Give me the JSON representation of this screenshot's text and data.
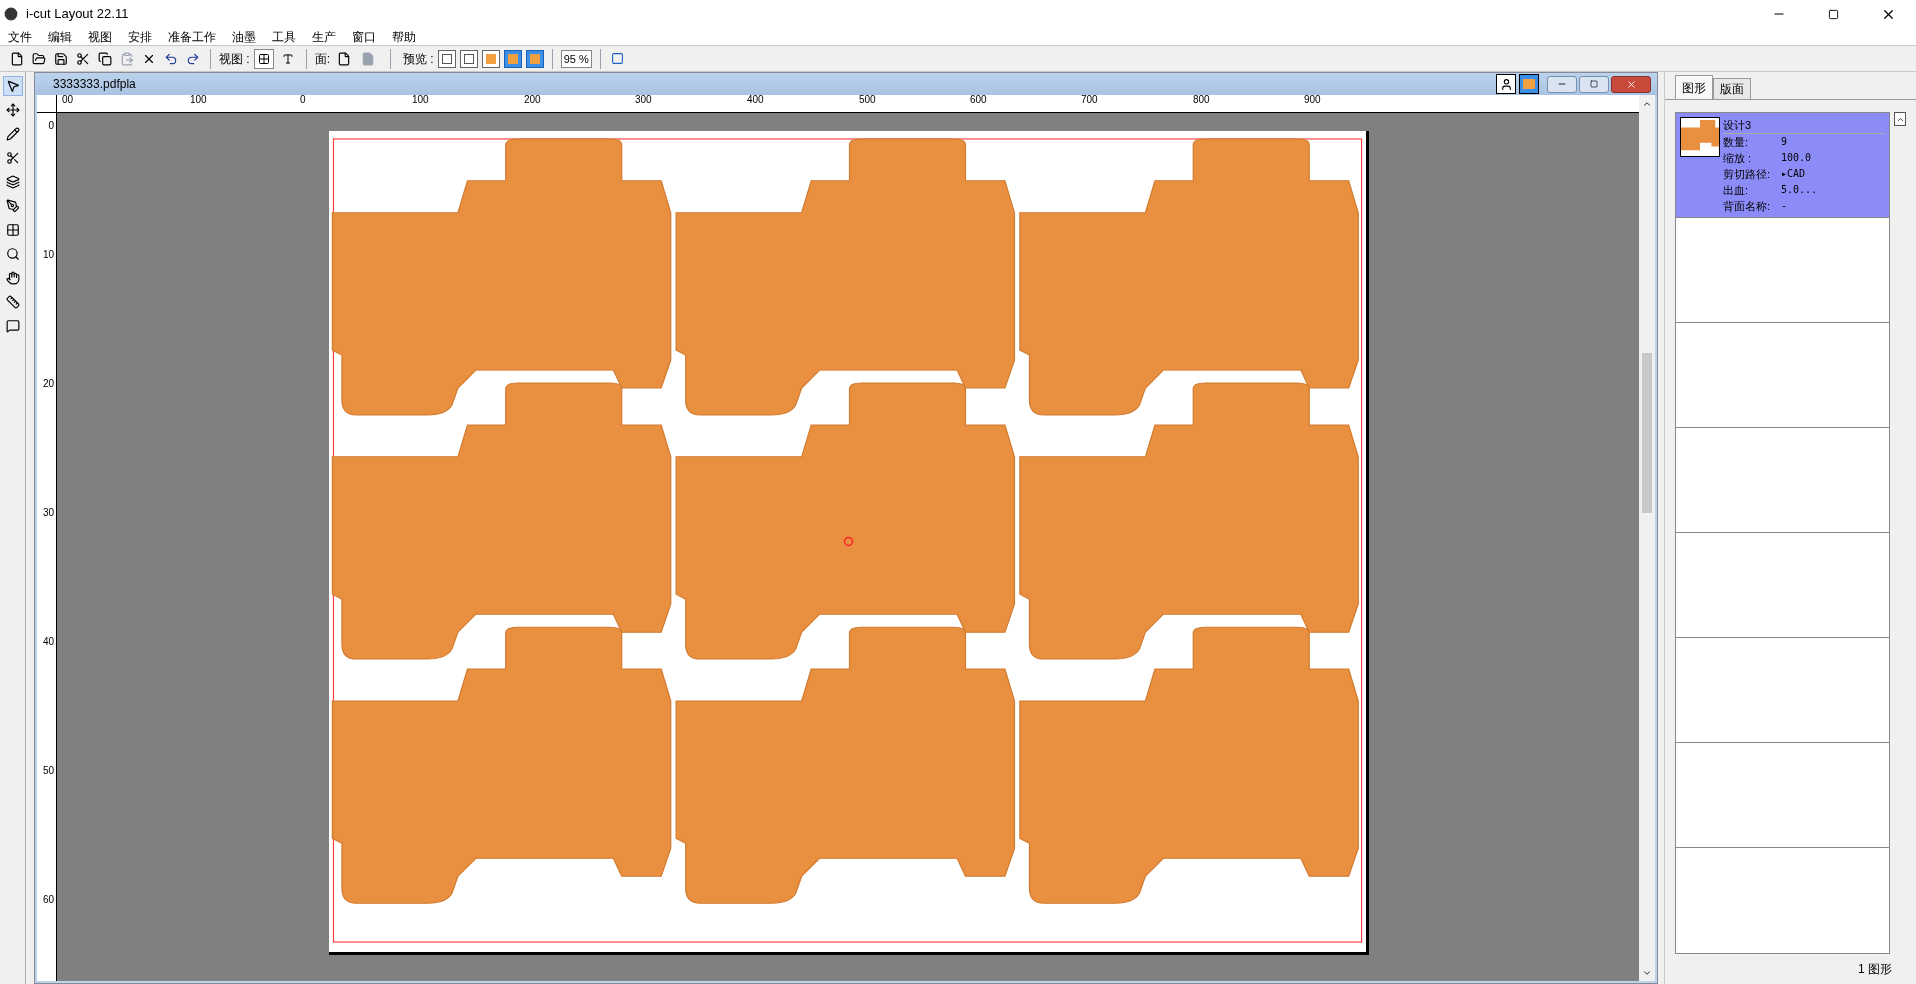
{
  "app_title": "i-cut Layout 22.11",
  "menu": [
    "文件",
    "编辑",
    "视图",
    "安排",
    "准备工作",
    "油墨",
    "工具",
    "生产",
    "窗口",
    "帮助"
  ],
  "toolbar": {
    "view_label": "视图 :",
    "view_modes": [
      {
        "selected": true
      },
      {
        "selected": false
      }
    ],
    "side_label": "面:",
    "preview_label": "预览 :",
    "preview_modes": [
      {
        "selected": false
      },
      {
        "selected": false
      },
      {
        "selected": false
      },
      {
        "selected": true
      },
      {
        "selected": true
      }
    ],
    "zoom": "95 %"
  },
  "tools": [
    {
      "selected": true
    },
    {
      "selected": false
    },
    {
      "selected": false
    },
    {
      "selected": false
    },
    {
      "selected": false
    },
    {
      "selected": false
    },
    {
      "selected": false
    },
    {
      "selected": false
    },
    {
      "selected": false
    },
    {
      "selected": false
    },
    {
      "selected": false
    }
  ],
  "document": {
    "title": "3333333.pdfpla",
    "h_ruler": [
      "00",
      "100",
      "0",
      "100",
      "200",
      "300",
      "400",
      "500",
      "600",
      "700",
      "800",
      "900"
    ],
    "v_ruler": [
      "0",
      "10",
      "20",
      "30",
      "40",
      "50",
      "60"
    ]
  },
  "panel": {
    "tabs": [
      {
        "label": "图形",
        "selected": true
      },
      {
        "label": "版面",
        "selected": false
      }
    ],
    "designs": [
      {
        "name": "设计3",
        "selected": true,
        "fields": [
          {
            "label": "数量:",
            "value": "9"
          },
          {
            "label": "缩放 :",
            "value": "100.0"
          },
          {
            "label": "剪切路径:",
            "value": "▸CAD"
          },
          {
            "label": "出血:",
            "value": "5.0..."
          },
          {
            "label": "背面名称:",
            "value": "-"
          }
        ]
      }
    ],
    "status": "1 图形"
  }
}
